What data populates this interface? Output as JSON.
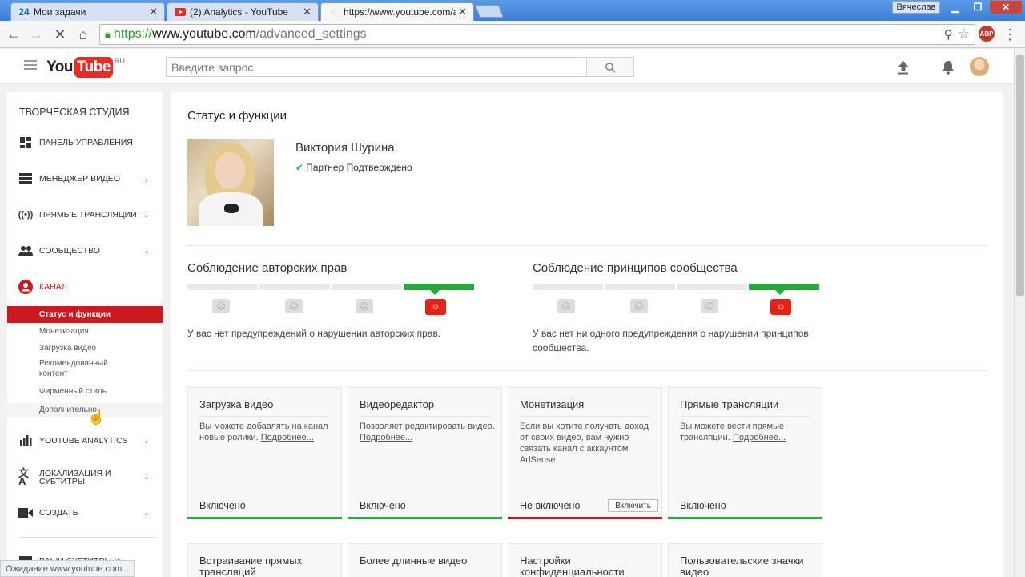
{
  "browser": {
    "tabs": [
      {
        "label": "Мои задачи",
        "icon": "24"
      },
      {
        "label": "(2) Analytics - YouTube",
        "icon": "youtube"
      },
      {
        "label": "https://www.youtube.com/a",
        "icon": "loading"
      }
    ],
    "user": "Вячеслав",
    "url": {
      "scheme": "https://",
      "host": "www.youtube.com",
      "path": "/advanced_settings"
    },
    "abp": "ABP"
  },
  "youtube": {
    "logo_you": "You",
    "logo_tube": "Tube",
    "logo_region": "RU",
    "search_placeholder": "Введите запрос"
  },
  "sidebar": {
    "title": "ТВОРЧЕСКАЯ СТУДИЯ",
    "items": [
      {
        "label": "ПАНЕЛЬ УПРАВЛЕНИЯ",
        "icon": "dashboard-icon"
      },
      {
        "label": "МЕНЕДЖЕР ВИДЕО",
        "icon": "video-manager-icon"
      },
      {
        "label": "ПРЯМЫЕ ТРАНСЛЯЦИИ",
        "icon": "live-icon"
      },
      {
        "label": "СООБЩЕСТВО",
        "icon": "community-icon"
      },
      {
        "label": "КАНАЛ",
        "icon": "channel-icon"
      },
      {
        "label": "YOUTUBE ANALYTICS",
        "icon": "analytics-icon"
      },
      {
        "label": "ЛОКАЛИЗАЦИЯ И СУБТИТРЫ",
        "icon": "translate-icon"
      },
      {
        "label": "СОЗДАТЬ",
        "icon": "create-icon"
      },
      {
        "label": "ВАШИ СУБТИТРЫ И ...",
        "icon": "subtitles-icon"
      }
    ],
    "channel_sub": [
      "Статус и функции",
      "Монетизация",
      "Загрузка видео",
      "Рекомендованный контент",
      "Фирменный стиль",
      "Дополнительно"
    ]
  },
  "main": {
    "title": "Статус и функции",
    "user_name": "Виктория Шурина",
    "partner": "Партнер Подтверждено",
    "copyright": {
      "title": "Соблюдение авторских прав",
      "text": "У вас нет предупреждений о нарушении авторских прав."
    },
    "community": {
      "title": "Соблюдение принципов сообщества",
      "text": "У вас нет ни одного предупреждения о нарушении принципов сообщества."
    },
    "cards": [
      {
        "title": "Загрузка видео",
        "desc": "Вы можете добавлять на канал новые ролики.",
        "more": "Подробнее...",
        "status": "Включено",
        "color": "#2ba640"
      },
      {
        "title": "Видеоредактор",
        "desc": "Позволяет редактировать видео.",
        "more": "Подробнее...",
        "status": "Включено",
        "color": "#2ba640"
      },
      {
        "title": "Монетизация",
        "desc": "Если вы хотите получать доход от своих видео, вам нужно связать канал с аккаунтом AdSense.",
        "more": "",
        "status": "Не включено",
        "button": "Включить",
        "color": "#cc181e"
      },
      {
        "title": "Прямые трансляции",
        "desc": "Вы можете вести прямые трансляции.",
        "more": "Подробнее...",
        "status": "Включено",
        "color": "#2ba640"
      }
    ],
    "cards_row2": [
      "Встраивание прямых трансляций",
      "Более длинные видео",
      "Настройки конфиденциальности",
      "Пользовательские значки видео"
    ]
  },
  "status_bar": "Ожидание www.youtube.com..."
}
